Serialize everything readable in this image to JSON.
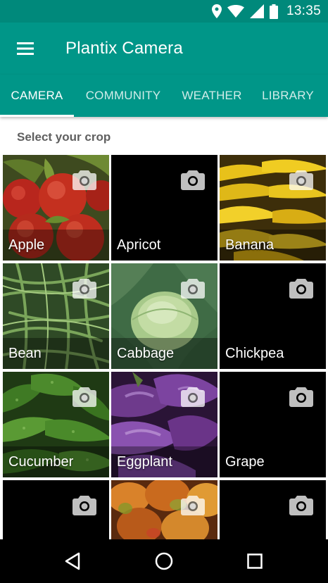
{
  "status_bar": {
    "time": "13:35",
    "icons": [
      "location-icon",
      "wifi-icon",
      "signal-icon",
      "battery-icon"
    ]
  },
  "app_bar": {
    "title": "Plantix Camera",
    "menu_icon": "hamburger-menu-icon"
  },
  "tabs": [
    {
      "label": "CAMERA",
      "active": true
    },
    {
      "label": "COMMUNITY",
      "active": false
    },
    {
      "label": "WEATHER",
      "active": false
    },
    {
      "label": "LIBRARY",
      "active": false
    }
  ],
  "section_title": "Select your crop",
  "crops": [
    {
      "label": "Apple",
      "visual": "apple"
    },
    {
      "label": "Apricot",
      "visual": "black"
    },
    {
      "label": "Banana",
      "visual": "banana"
    },
    {
      "label": "Bean",
      "visual": "bean"
    },
    {
      "label": "Cabbage",
      "visual": "cabbage"
    },
    {
      "label": "Chickpea",
      "visual": "black"
    },
    {
      "label": "Cucumber",
      "visual": "cucumber"
    },
    {
      "label": "Eggplant",
      "visual": "eggplant"
    },
    {
      "label": "Grape",
      "visual": "black"
    },
    {
      "label": "",
      "visual": "black"
    },
    {
      "label": "",
      "visual": "mango"
    },
    {
      "label": "",
      "visual": "black"
    }
  ],
  "nav_bar": {
    "buttons": [
      "back-icon",
      "home-icon",
      "recents-icon"
    ]
  },
  "colors": {
    "status_bar": "#00897b",
    "primary": "#009688",
    "nav_bar": "#000000"
  }
}
